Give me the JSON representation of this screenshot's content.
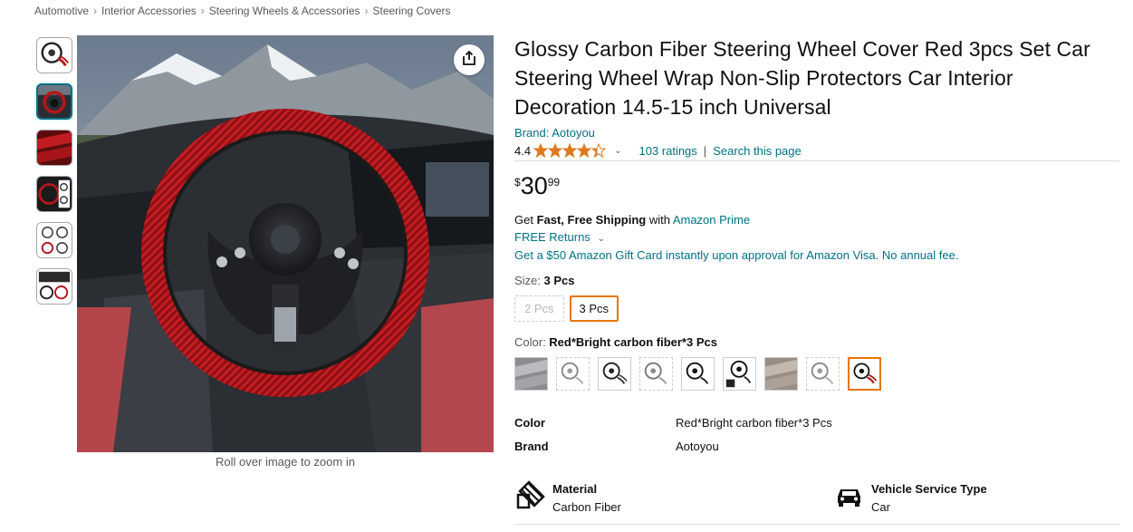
{
  "breadcrumb": [
    "Automotive",
    "Interior Accessories",
    "Steering Wheels & Accessories",
    "Steering Covers"
  ],
  "breadcrumb_sep": "›",
  "gallery": {
    "thumbnail_count": 6,
    "selected_index": 1,
    "zoom_hint": "Roll over image to zoom in",
    "share_icon": "share-icon"
  },
  "product": {
    "title": "Glossy Carbon Fiber Steering Wheel Cover Red 3pcs Set Car Steering Wheel Wrap Non-Slip Protectors Car Interior Decoration 14.5-15 inch Universal",
    "brand_link": "Brand: Aotoyou",
    "rating_value": "4.4",
    "rating_stars": 4.4,
    "rating_count": "103 ratings",
    "search_link": "Search this page",
    "pipe": "|"
  },
  "price": {
    "symbol": "$",
    "whole": "30",
    "fraction": "99"
  },
  "shipping": {
    "prefix": "Get ",
    "bold": "Fast, Free Shipping",
    "middle": " with ",
    "link": "Amazon Prime",
    "returns": "FREE Returns",
    "returns_chevron": "⌄",
    "gift_card": "Get a $50 Amazon Gift Card instantly upon approval for Amazon Visa. No annual fee."
  },
  "size": {
    "label": "Size: ",
    "selected": "3 Pcs",
    "options": [
      "2 Pcs",
      "3 Pcs"
    ]
  },
  "color": {
    "label": "Color: ",
    "selected": "Red*Bright carbon fiber*3 Pcs",
    "swatch_count": 9,
    "selected_index": 8
  },
  "specs": [
    {
      "name": "Color",
      "value": "Red*Bright carbon fiber*3 Pcs"
    },
    {
      "name": "Brand",
      "value": "Aotoyou"
    }
  ],
  "features": [
    {
      "name": "Material",
      "value": "Carbon Fiber",
      "icon": "material-icon"
    },
    {
      "name": "Vehicle Service Type",
      "value": "Car",
      "icon": "car-icon"
    }
  ],
  "colors": {
    "link": "#007185",
    "star": "#de7921",
    "selected_border": "#e77600",
    "cover_red": "#b3161b"
  }
}
